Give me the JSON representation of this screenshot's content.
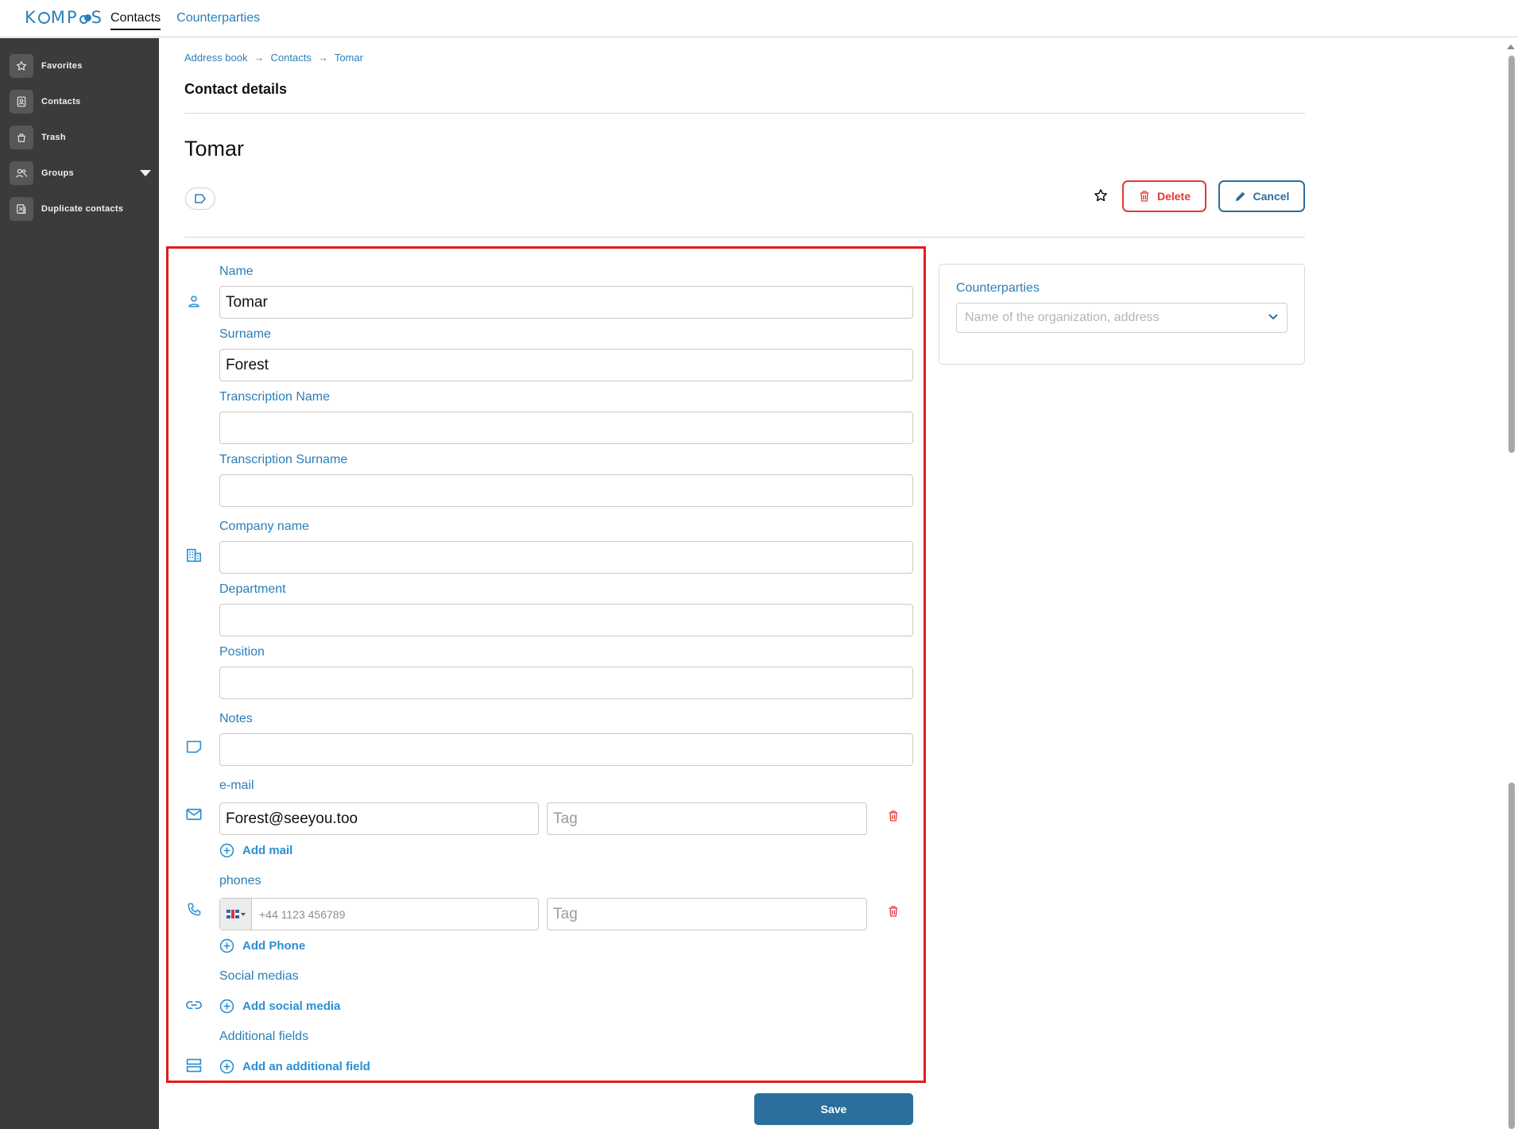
{
  "app": {
    "logo": "KOMPAS",
    "nav": [
      {
        "label": "Contacts",
        "active": true
      },
      {
        "label": "Counterparties",
        "active": false
      }
    ]
  },
  "sidebar": {
    "items": [
      {
        "label": "Favorites",
        "icon": "star-icon"
      },
      {
        "label": "Contacts",
        "icon": "contacts-icon"
      },
      {
        "label": "Trash",
        "icon": "trash-icon"
      },
      {
        "label": "Groups",
        "icon": "users-icon"
      },
      {
        "label": "Duplicate contacts",
        "icon": "duplicate-icon"
      }
    ]
  },
  "breadcrumb": [
    "Address book",
    "Contacts",
    "Tomar"
  ],
  "page_title": "Contact details",
  "contact_name": "Tomar",
  "actions": {
    "delete": "Delete",
    "cancel": "Cancel",
    "save": "Save"
  },
  "form": {
    "name": {
      "label": "Name",
      "value": "Tomar"
    },
    "surname": {
      "label": "Surname",
      "value": "Forest"
    },
    "transcription_name": {
      "label": "Transcription Name",
      "value": ""
    },
    "transcription_surname": {
      "label": "Transcription Surname",
      "value": ""
    },
    "company_name": {
      "label": "Company name",
      "value": ""
    },
    "department": {
      "label": "Department",
      "value": ""
    },
    "position": {
      "label": "Position",
      "value": ""
    },
    "notes": {
      "label": "Notes",
      "value": ""
    },
    "email": {
      "label": "e-mail",
      "value": "Forest@seeyou.too",
      "tag_placeholder": "Tag",
      "add_label": "Add mail"
    },
    "phones": {
      "label": "phones",
      "placeholder": "+44 1123 456789",
      "tag_placeholder": "Tag",
      "add_label": "Add Phone"
    },
    "social": {
      "label": "Social medias",
      "add_label": "Add social media"
    },
    "additional": {
      "label": "Additional fields",
      "add_label": "Add an additional field"
    }
  },
  "counterparties": {
    "label": "Counterparties",
    "placeholder": "Name of the organization, address"
  },
  "colors": {
    "accent": "#2a7fb8",
    "danger": "#e53935",
    "sidebar_bg": "#3b3b3b",
    "primary_button": "#2a6f9e",
    "highlight_frame": "#e21b1b"
  }
}
